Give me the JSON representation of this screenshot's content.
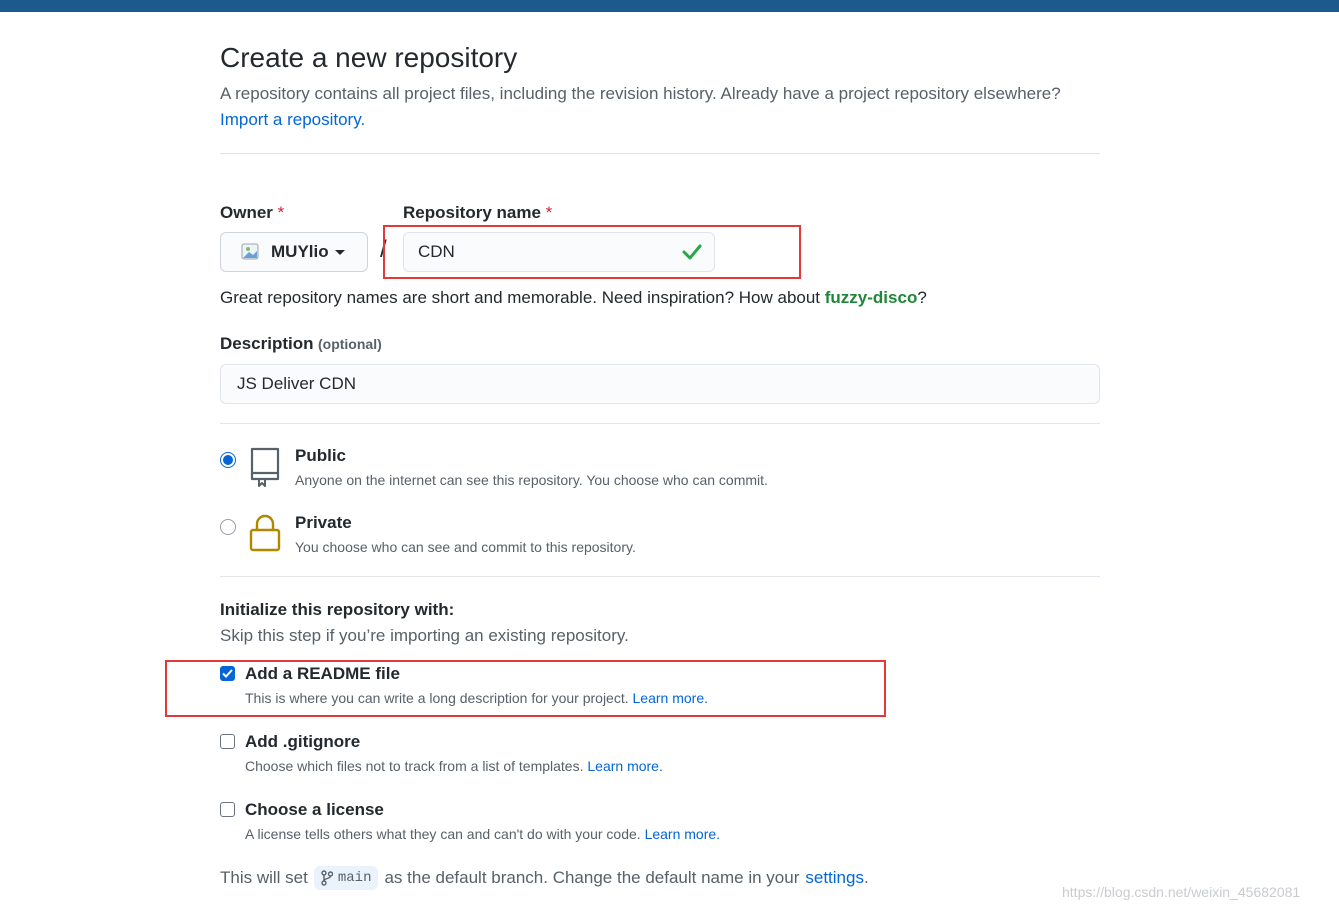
{
  "header": {
    "title": "Create a new repository",
    "subtitle": "A repository contains all project files, including the revision history. Already have a project repository elsewhere?",
    "import_link": "Import a repository."
  },
  "owner": {
    "label": "Owner",
    "required_mark": "*",
    "value": "MUYlio"
  },
  "separator": "/",
  "repo_name": {
    "label": "Repository name",
    "required_mark": "*",
    "value": "CDN",
    "valid_icon": "check-icon"
  },
  "name_hint": {
    "text": "Great repository names are short and memorable. Need inspiration? How about",
    "suggestion": "fuzzy-disco",
    "end": "?"
  },
  "description": {
    "label": "Description",
    "optional": "(optional)",
    "value": "JS Deliver CDN"
  },
  "visibility": {
    "public": {
      "title": "Public",
      "desc": "Anyone on the internet can see this repository. You choose who can commit.",
      "selected": true,
      "icon": "repo-icon"
    },
    "private": {
      "title": "Private",
      "desc": "You choose who can see and commit to this repository.",
      "selected": false,
      "icon": "lock-icon"
    }
  },
  "init": {
    "title": "Initialize this repository with:",
    "subtitle": "Skip this step if you’re importing an existing repository.",
    "options": [
      {
        "title": "Add a README file",
        "desc": "This is where you can write a long description for your project.",
        "link": "Learn more.",
        "checked": true
      },
      {
        "title": "Add .gitignore",
        "desc": "Choose which files not to track from a list of templates.",
        "link": "Learn more.",
        "checked": false
      },
      {
        "title": "Choose a license",
        "desc": "A license tells others what they can and can't do with your code.",
        "link": "Learn more.",
        "checked": false
      }
    ]
  },
  "branch": {
    "prefix": "This will set",
    "name": "main",
    "middle": "as the default branch. Change the default name in your",
    "link": "settings",
    "end": "."
  },
  "watermark": "https://blog.csdn.net/weixin_45682081",
  "colors": {
    "link": "#0366d6",
    "required": "#cb2431",
    "suggestion": "#22863a",
    "lock_icon": "#b08800",
    "annotation_box": "#e03a3a"
  }
}
